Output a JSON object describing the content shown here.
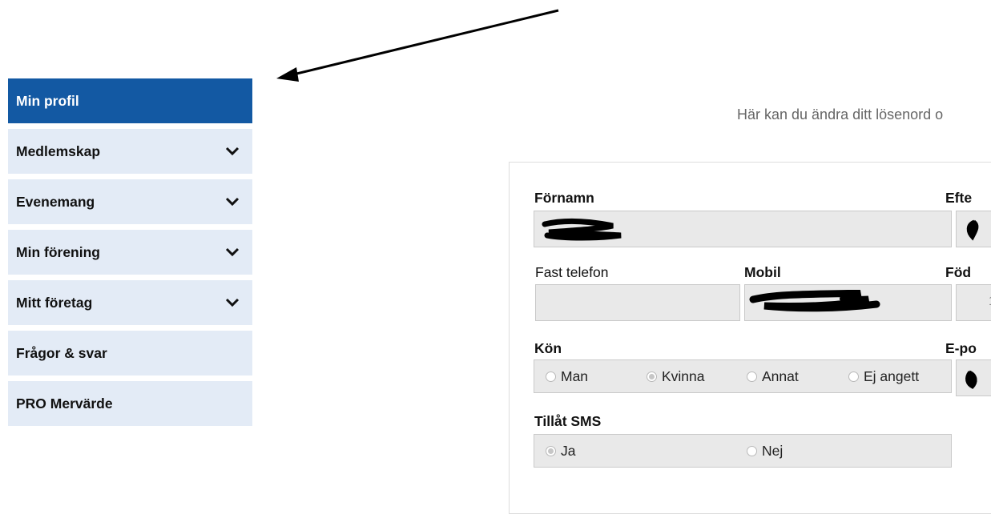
{
  "sidebar": {
    "items": [
      {
        "label": "Min profil",
        "active": true,
        "has_chevron": false
      },
      {
        "label": "Medlemskap",
        "active": false,
        "has_chevron": true
      },
      {
        "label": "Evenemang",
        "active": false,
        "has_chevron": true
      },
      {
        "label": "Min förening",
        "active": false,
        "has_chevron": true
      },
      {
        "label": "Mitt företag",
        "active": false,
        "has_chevron": true
      },
      {
        "label": "Frågor & svar",
        "active": false,
        "has_chevron": false
      },
      {
        "label": "PRO Mervärde",
        "active": false,
        "has_chevron": false
      }
    ],
    "chevron_icon": "chevron-down-icon"
  },
  "intro_text": "Här kan du ändra ditt lösenord o",
  "form": {
    "fornamn_label": "Förnamn",
    "efternamn_label": "Efte",
    "fast_telefon_label": "Fast telefon",
    "mobil_label": "Mobil",
    "fodelse_label": "Föd",
    "kon_label": "Kön",
    "epost_label": "E-po",
    "kon_options": [
      "Man",
      "Kvinna",
      "Annat",
      "Ej angett"
    ],
    "kon_selected": "Kvinna",
    "sms_label": "Tillåt SMS",
    "sms_options": [
      "Ja",
      "Nej"
    ],
    "sms_selected": "Ja",
    "fodelse_value_partial": "1"
  },
  "colors": {
    "active_nav": "#1359a3",
    "nav_bg": "#e3ebf6",
    "field_bg": "#e9e9e9",
    "intro_text": "#666666"
  }
}
